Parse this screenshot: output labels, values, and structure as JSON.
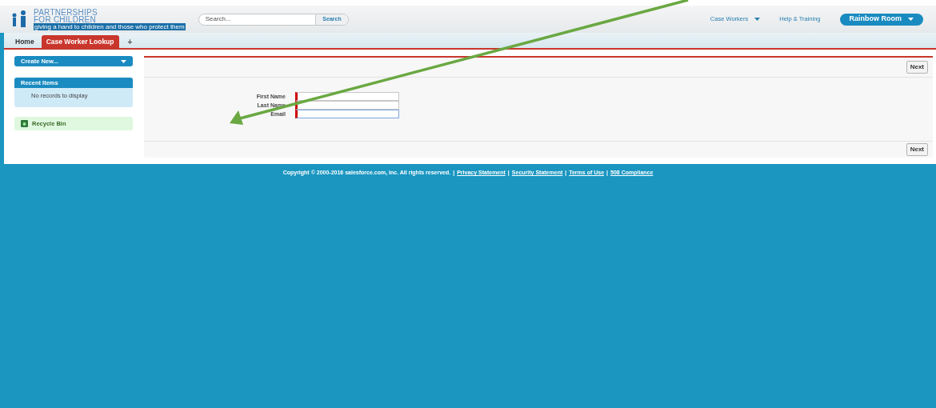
{
  "header": {
    "logo": {
      "line_1": "PARTNERSHIPS",
      "line_2": "FOR CHILDREN",
      "tagline": "giving a hand to children and those who protect them"
    },
    "search": {
      "placeholder": "Search...",
      "button": "Search"
    },
    "nav": [
      {
        "label": "Case Workers",
        "dropdown": true
      },
      {
        "label": "Help & Training",
        "dropdown": false
      }
    ],
    "user_menu": "Rainbow Room"
  },
  "tabs": [
    {
      "label": "Home",
      "selected": false
    },
    {
      "label": "Case Worker Lookup",
      "selected": true
    }
  ],
  "add_tab": "+",
  "sidebar": {
    "create_new": "Create New...",
    "recent_items": {
      "title": "Recent Items",
      "empty": "No records to display"
    },
    "recycle_bin": "Recycle Bin"
  },
  "form": {
    "fields": [
      {
        "label": "First Name",
        "required": true,
        "focused": false
      },
      {
        "label": "Last Name",
        "required": true,
        "focused": false
      },
      {
        "label": "Email",
        "required": true,
        "focused": true
      }
    ],
    "buttons": [
      "Next",
      "Next"
    ]
  },
  "footer": {
    "copyright": "Copyright © 2000-2016 salesforce.com, inc. All rights reserved.",
    "separator": "|",
    "links": [
      "Privacy Statement",
      "Security Statement",
      "Terms of Use",
      "508 Compliance"
    ]
  }
}
